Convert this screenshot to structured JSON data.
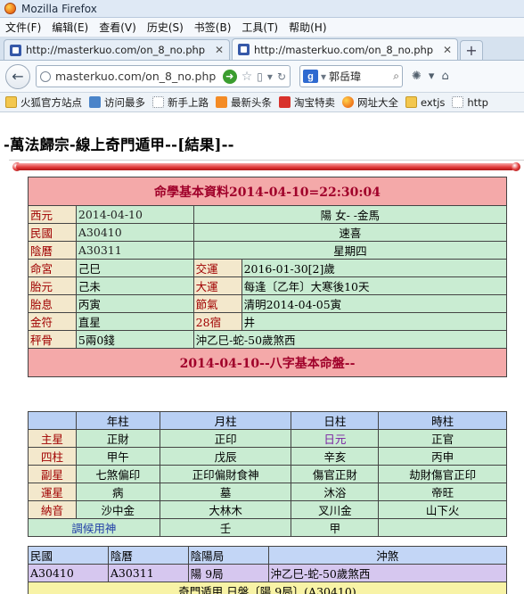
{
  "window": {
    "title": "Mozilla Firefox"
  },
  "menu": [
    "文件(F)",
    "编辑(E)",
    "查看(V)",
    "历史(S)",
    "书签(B)",
    "工具(T)",
    "帮助(H)"
  ],
  "tabs": [
    {
      "title": "http://masterkuo.com/on_8_no.php"
    },
    {
      "title": "http://masterkuo.com/on_8_no.php"
    }
  ],
  "newtab": "+",
  "nav": {
    "url": "masterkuo.com/on_8_no.php",
    "search_value": "郭岳瑋"
  },
  "bookmarks": [
    "火狐官方站点",
    "访问最多",
    "新手上路",
    "最新头条",
    "淘宝特卖",
    "网址大全",
    "extjs",
    "http"
  ],
  "page": {
    "heading": "-萬法歸宗-線上奇門遁甲--[結果]--",
    "info": {
      "title": "命學基本資料2014-04-10=22:30:04",
      "rows": [
        {
          "l1": "西元",
          "v1": "2014-04-10",
          "v2": "陽 女- -金馬"
        },
        {
          "l1": "民國",
          "v1": "A30410",
          "v2": "速喜"
        },
        {
          "l1": "陰曆",
          "v1": "A30311",
          "v2": "星期四"
        }
      ],
      "rows4": [
        {
          "l1": "命宮",
          "v1": "己巳",
          "l2": "交運",
          "v2": "2016-01-30[2]歲"
        },
        {
          "l1": "胎元",
          "v1": "己未",
          "l2": "大運",
          "v2": "每逢〔乙年〕大寒後10天"
        },
        {
          "l1": "胎息",
          "v1": "丙寅",
          "l2": "節氣",
          "v2": "清明2014-04-05寅"
        },
        {
          "l1": "金符",
          "v1": "直星",
          "l2": "28宿",
          "v2": "井"
        }
      ],
      "weight": {
        "label": "秤骨",
        "v1": "5兩0錢",
        "v2": "沖乙巳-蛇-50歲煞西"
      }
    },
    "bazi": {
      "title": "2014-04-10--八字基本命盤--",
      "cols": [
        "年柱",
        "月柱",
        "日柱",
        "時柱"
      ],
      "rows": [
        {
          "label": "主星",
          "cells": [
            "正財",
            "正印",
            "日元",
            "正官"
          ]
        },
        {
          "label": "四柱",
          "cells": [
            "甲午",
            "戊辰",
            "辛亥",
            "丙申"
          ]
        },
        {
          "label": "副星",
          "cells": [
            "七煞偏印",
            "正印偏財食神",
            "傷官正財",
            "劫財傷官正印"
          ]
        },
        {
          "label": "運星",
          "cells": [
            "病",
            "墓",
            "沐浴",
            "帝旺"
          ]
        },
        {
          "label": "納音",
          "cells": [
            "沙中金",
            "大林木",
            "叉川金",
            "山下火"
          ]
        },
        {
          "label": "調候用神",
          "cells": [
            "",
            "壬",
            "甲",
            ""
          ]
        }
      ]
    },
    "qimen": {
      "headers": [
        "民國",
        "陰曆",
        "陰陽局",
        "沖煞"
      ],
      "values": [
        "A30410",
        "A30311",
        "陽 9局",
        "沖乙巳-蛇-50歲煞西"
      ],
      "footer": "奇門遁甲 日盤〔陽 9局〕(A30410)"
    }
  }
}
